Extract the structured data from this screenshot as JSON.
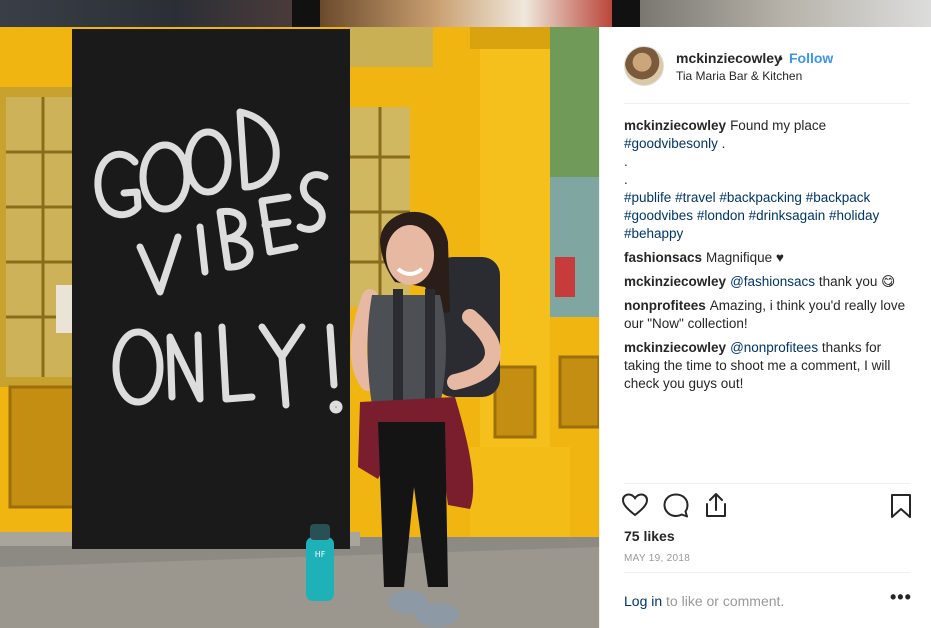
{
  "post": {
    "author": "mckinziecowley",
    "separator": "•",
    "follow_label": "Follow",
    "location": "Tia Maria Bar & Kitchen",
    "photo": {
      "sign_line1": "GOOD",
      "sign_line2": "VIBES",
      "sign_line3": "ONLY!",
      "bottle_letters": "HF"
    },
    "caption": {
      "user": "mckinziecowley",
      "text": "Found my place",
      "tag1": "#goodvibesonly",
      "after_tag1": " .",
      "dot1": ".",
      "dot2": ".",
      "tags_line1": [
        "#publife",
        "#travel",
        "#backpacking",
        "#backpack"
      ],
      "tags_line2": [
        "#goodvibes",
        "#london",
        "#drinksagain",
        "#holiday"
      ],
      "tags_line3": [
        "#behappy"
      ]
    },
    "comments": [
      {
        "user": "fashionsacs",
        "text": "Magnifique ♥"
      },
      {
        "user": "mckinziecowley",
        "mention": "@fashionsacs",
        "text": " thank you 😋"
      },
      {
        "user": "nonprofitees",
        "text": "Amazing, i think you'd really love our \"Now\" collection!"
      },
      {
        "user": "mckinziecowley",
        "mention": "@nonprofitees",
        "text": " thanks for taking the time to shoot me a comment, I will check you guys out!"
      }
    ],
    "icons": {
      "like": "heart-icon",
      "comment": "comment-bubble-icon",
      "share": "share-icon",
      "save": "bookmark-icon",
      "more": "more-options-icon"
    },
    "likes": "75 likes",
    "date": "MAY 19, 2018",
    "login_link": "Log in",
    "login_rest": " to like or comment.",
    "more_label": "•••",
    "colors": {
      "link": "#003569",
      "follow": "#3897f0",
      "muted": "#999999",
      "wall": "#f2b713"
    }
  }
}
